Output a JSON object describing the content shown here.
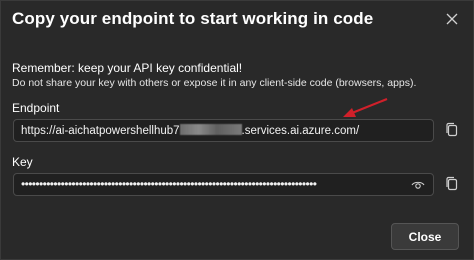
{
  "dialog": {
    "title": "Copy your endpoint to start working in code",
    "close_icon": "close-icon"
  },
  "notice": {
    "title": "Remember: keep your API key confidential!",
    "body": "Do not share your key with others or expose it in any client-side code (browsers, apps)."
  },
  "endpoint": {
    "label": "Endpoint",
    "value_prefix": "https://ai-aichatpowershellhub7",
    "value_suffix": ".services.ai.azure.com/",
    "copy_icon": "copy-icon"
  },
  "key": {
    "label": "Key",
    "masked_value": "••••••••••••••••••••••••••••••••••••••••••••••••••••••••••••••••••••••••••••••••••",
    "reveal_icon": "eye-icon",
    "copy_icon": "copy-icon"
  },
  "footer": {
    "close_label": "Close"
  },
  "colors": {
    "background": "#292929",
    "annotation_arrow": "#d0202a"
  }
}
